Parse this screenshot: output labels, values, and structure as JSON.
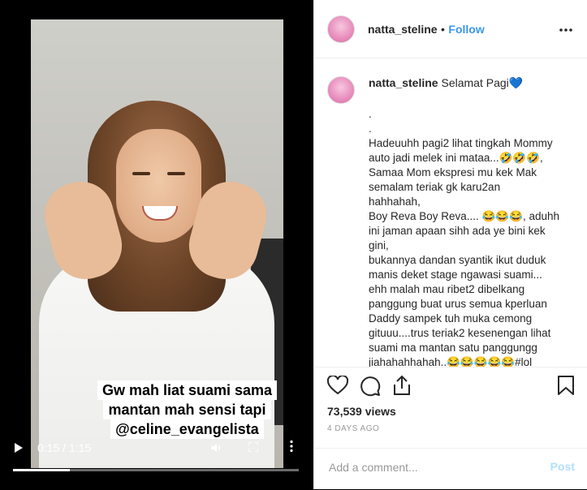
{
  "video": {
    "caption_lines": [
      "Gw mah liat suami sama",
      "mantan mah sensi tapi",
      "@celine_evangelista"
    ],
    "time": "0:15 / 1:15",
    "progress": 0.2
  },
  "header": {
    "username": "natta_steline",
    "separator": "•",
    "follow_label": "Follow",
    "more_icon": "•••"
  },
  "post": {
    "username": "natta_steline",
    "caption_first": "Selamat Pagi💙",
    "caption_lines": [
      ".",
      ".",
      "Hadeuuhh pagi2 lihat tingkah Mommy",
      "auto jadi melek ini mataa...🤣🤣🤣,",
      "Samaa Mom ekspresi mu kek Mak",
      "semalam teriak gk karu2an",
      "hahhahah,",
      "Boy Reva Boy Reva.... 😂😂😂, aduhh",
      "ini jaman apaan sihh ada ye bini kek",
      "gini,",
      "bukannya dandan syantik ikut duduk",
      "manis deket stage ngawasi suami...",
      "ehh malah mau ribet2 dibelkang",
      "panggung buat urus semua kperluan",
      "Daddy sampek tuh muka cemong",
      "gituuu....trus teriak2 kesenengan lihat",
      "suami ma mantan satu panggungg",
      "jiahahahhahah..😂😂😂😂😂#lol"
    ]
  },
  "actions": {
    "views": "73,539 views",
    "ago": "4 DAYS AGO"
  },
  "comment": {
    "placeholder": "Add a comment...",
    "post_label": "Post"
  }
}
